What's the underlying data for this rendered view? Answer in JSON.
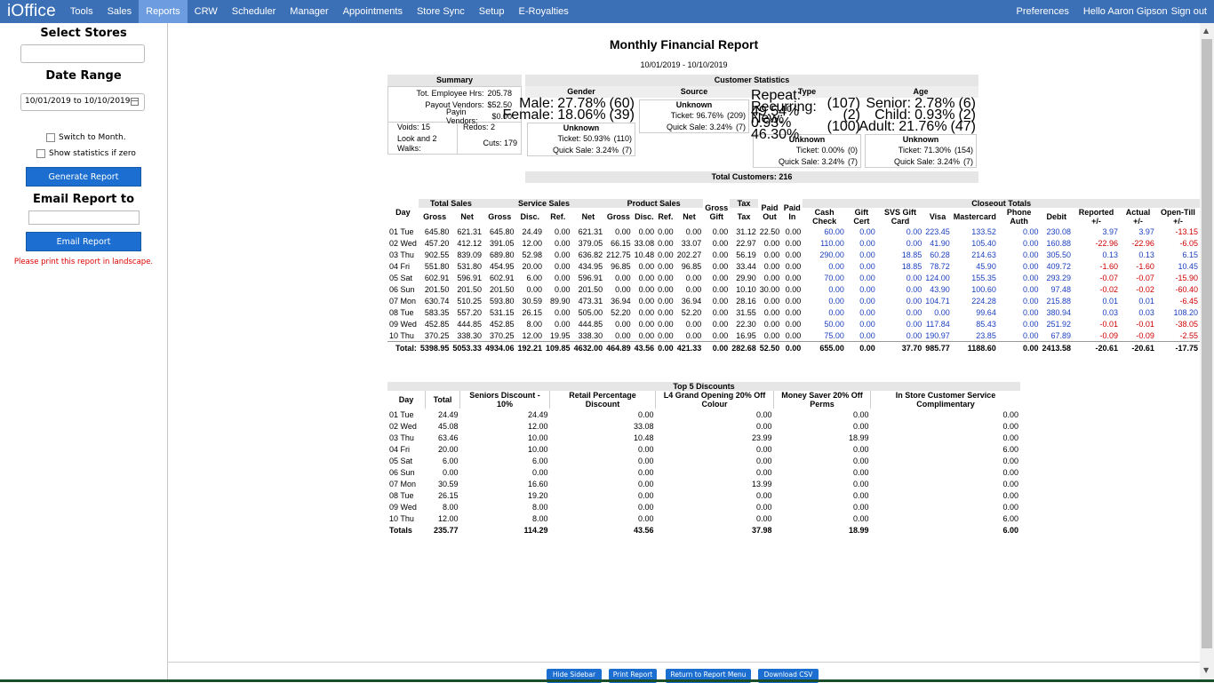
{
  "nav": {
    "logo": "iOffice",
    "items": [
      "Tools",
      "Sales",
      "Reports",
      "CRW",
      "Scheduler",
      "Manager",
      "Appointments",
      "Store Sync",
      "Setup",
      "E-Royalties"
    ],
    "active": "Reports",
    "preferences": "Preferences",
    "greeting": "Hello Aaron Gipson",
    "signout": "Sign out"
  },
  "sidebar": {
    "select_stores": "Select Stores",
    "date_range_title": "Date Range",
    "date_range_value": "10/01/2019 to 10/10/2019",
    "switch_month": "Switch to Month.",
    "show_stats": "Show statistics if zero",
    "generate": "Generate Report",
    "email_title": "Email Report to",
    "email_button": "Email Report",
    "print_note": "Please print this report in landscape."
  },
  "report": {
    "title": "Monthly Financial Report",
    "range": "10/01/2019 - 10/10/2019"
  },
  "summary": {
    "title": "Summary",
    "emp_hrs_label": "Tot. Employee Hrs:",
    "emp_hrs": "205.78",
    "payout_label": "Payout Vendors:",
    "payout": "$52.50",
    "payin_label": "Payin Vendors:",
    "payin": "$0.00",
    "voids": "Voids: 15",
    "redos": "Redos: 2",
    "look_walks": "Look and 2 Walks:",
    "cuts": "Cuts: 179"
  },
  "customer_stats": {
    "title": "Customer Statistics",
    "gender": {
      "title": "Gender",
      "male": "Male:",
      "male_pct": "27.78%",
      "male_n": "(60)",
      "female": "Female:",
      "female_pct": "18.06%",
      "female_n": "(39)",
      "unknown": "Unknown",
      "ticket": "Ticket: 50.93%",
      "ticket_n": "(110)",
      "quick": "Quick Sale: 3.24%",
      "quick_n": "(7)"
    },
    "source": {
      "title": "Source",
      "unknown": "Unknown",
      "ticket": "Ticket: 96.76%",
      "ticket_n": "(209)",
      "quick": "Quick Sale: 3.24%",
      "quick_n": "(7)"
    },
    "type": {
      "title": "Type",
      "repeat": "Repeat: 49.54%",
      "repeat_n": "(107)",
      "recurring": "Recurring: 0.93%",
      "recurring_n": "(2)",
      "new": "New: 46.30%",
      "new_n": "(100)",
      "unknown": "Unknown",
      "ticket": "Ticket: 0.00%",
      "ticket_n": "(0)",
      "quick": "Quick Sale: 3.24%",
      "quick_n": "(7)"
    },
    "age": {
      "title": "Age",
      "senior": "Senior:",
      "senior_pct": "2.78%",
      "senior_n": "(6)",
      "child": "Child:",
      "child_pct": "0.93%",
      "child_n": "(2)",
      "adult": "Adult:",
      "adult_pct": "21.76%",
      "adult_n": "(47)",
      "unknown": "Unknown",
      "ticket": "Ticket: 71.30%",
      "ticket_n": "(154)",
      "quick": "Quick Sale: 3.24%",
      "quick_n": "(7)"
    },
    "total": "Total Customers: 216"
  },
  "sales": {
    "groups": [
      "Total Sales",
      "Service Sales",
      "Product Sales",
      "Tax",
      "Closeout Totals"
    ],
    "headers": [
      "Day",
      "Gross",
      "Net",
      "Gross",
      "Disc.",
      "Ref.",
      "Net",
      "Gross",
      "Disc.",
      "Ref.",
      "Net",
      "Gross Gift",
      "Tax",
      "Paid Out",
      "Paid In",
      "Cash Check",
      "Gift Cert",
      "SVS Gift Card",
      "Visa",
      "Mastercard",
      "Phone Auth",
      "Debit",
      "Reported +/-",
      "Actual +/-",
      "Open-Till +/-"
    ],
    "rows": [
      [
        "01 Tue",
        "645.80",
        "621.31",
        "645.80",
        "24.49",
        "0.00",
        "621.31",
        "0.00",
        "0.00",
        "0.00",
        "0.00",
        "0.00",
        "31.12",
        "22.50",
        "0.00",
        "60.00",
        "0.00",
        "0.00",
        "223.45",
        "133.52",
        "0.00",
        "230.08",
        "3.97",
        "3.97",
        "-13.15"
      ],
      [
        "02 Wed",
        "457.20",
        "412.12",
        "391.05",
        "12.00",
        "0.00",
        "379.05",
        "66.15",
        "33.08",
        "0.00",
        "33.07",
        "0.00",
        "22.97",
        "0.00",
        "0.00",
        "110.00",
        "0.00",
        "0.00",
        "41.90",
        "105.40",
        "0.00",
        "160.88",
        "-22.96",
        "-22.96",
        "-6.05"
      ],
      [
        "03 Thu",
        "902.55",
        "839.09",
        "689.80",
        "52.98",
        "0.00",
        "636.82",
        "212.75",
        "10.48",
        "0.00",
        "202.27",
        "0.00",
        "56.19",
        "0.00",
        "0.00",
        "290.00",
        "0.00",
        "18.85",
        "60.28",
        "214.63",
        "0.00",
        "305.50",
        "0.13",
        "0.13",
        "6.15"
      ],
      [
        "04 Fri",
        "551.80",
        "531.80",
        "454.95",
        "20.00",
        "0.00",
        "434.95",
        "96.85",
        "0.00",
        "0.00",
        "96.85",
        "0.00",
        "33.44",
        "0.00",
        "0.00",
        "0.00",
        "0.00",
        "18.85",
        "78.72",
        "45.90",
        "0.00",
        "409.72",
        "-1.60",
        "-1.60",
        "10.45"
      ],
      [
        "05 Sat",
        "602.91",
        "596.91",
        "602.91",
        "6.00",
        "0.00",
        "596.91",
        "0.00",
        "0.00",
        "0.00",
        "0.00",
        "0.00",
        "29.90",
        "0.00",
        "0.00",
        "70.00",
        "0.00",
        "0.00",
        "124.00",
        "155.35",
        "0.00",
        "293.29",
        "-0.07",
        "-0.07",
        "-15.90"
      ],
      [
        "06 Sun",
        "201.50",
        "201.50",
        "201.50",
        "0.00",
        "0.00",
        "201.50",
        "0.00",
        "0.00",
        "0.00",
        "0.00",
        "0.00",
        "10.10",
        "30.00",
        "0.00",
        "0.00",
        "0.00",
        "0.00",
        "43.90",
        "100.60",
        "0.00",
        "97.48",
        "-0.02",
        "-0.02",
        "-60.40"
      ],
      [
        "07 Mon",
        "630.74",
        "510.25",
        "593.80",
        "30.59",
        "89.90",
        "473.31",
        "36.94",
        "0.00",
        "0.00",
        "36.94",
        "0.00",
        "28.16",
        "0.00",
        "0.00",
        "0.00",
        "0.00",
        "0.00",
        "104.71",
        "224.28",
        "0.00",
        "215.88",
        "0.01",
        "0.01",
        "-6.45"
      ],
      [
        "08 Tue",
        "583.35",
        "557.20",
        "531.15",
        "26.15",
        "0.00",
        "505.00",
        "52.20",
        "0.00",
        "0.00",
        "52.20",
        "0.00",
        "31.55",
        "0.00",
        "0.00",
        "0.00",
        "0.00",
        "0.00",
        "0.00",
        "99.64",
        "0.00",
        "380.94",
        "0.03",
        "0.03",
        "108.20"
      ],
      [
        "09 Wed",
        "452.85",
        "444.85",
        "452.85",
        "8.00",
        "0.00",
        "444.85",
        "0.00",
        "0.00",
        "0.00",
        "0.00",
        "0.00",
        "22.30",
        "0.00",
        "0.00",
        "50.00",
        "0.00",
        "0.00",
        "117.84",
        "85.43",
        "0.00",
        "251.92",
        "-0.01",
        "-0.01",
        "-38.05"
      ],
      [
        "10 Thu",
        "370.25",
        "338.30",
        "370.25",
        "12.00",
        "19.95",
        "338.30",
        "0.00",
        "0.00",
        "0.00",
        "0.00",
        "0.00",
        "16.95",
        "0.00",
        "0.00",
        "75.00",
        "0.00",
        "0.00",
        "190.97",
        "23.85",
        "0.00",
        "67.89",
        "-0.09",
        "-0.09",
        "-2.55"
      ]
    ],
    "totals": [
      "Total:",
      "5398.95",
      "5053.33",
      "4934.06",
      "192.21",
      "109.85",
      "4632.00",
      "464.89",
      "43.56",
      "0.00",
      "421.33",
      "0.00",
      "282.68",
      "52.50",
      "0.00",
      "655.00",
      "0.00",
      "37.70",
      "985.77",
      "1188.60",
      "0.00",
      "2413.58",
      "-20.61",
      "-20.61",
      "-17.75"
    ]
  },
  "discounts": {
    "title": "Top 5 Discounts",
    "headers": [
      "Day",
      "Total",
      "Seniors Discount - 10%",
      "Retail Percentage Discount",
      "L4 Grand Opening 20% Off Colour",
      "Money Saver 20% Off Perms",
      "In Store Customer Service Complimentary"
    ],
    "rows": [
      [
        "01 Tue",
        "24.49",
        "24.49",
        "0.00",
        "0.00",
        "0.00",
        "0.00"
      ],
      [
        "02 Wed",
        "45.08",
        "12.00",
        "33.08",
        "0.00",
        "0.00",
        "0.00"
      ],
      [
        "03 Thu",
        "63.46",
        "10.00",
        "10.48",
        "23.99",
        "18.99",
        "0.00"
      ],
      [
        "04 Fri",
        "20.00",
        "10.00",
        "0.00",
        "0.00",
        "0.00",
        "6.00"
      ],
      [
        "05 Sat",
        "6.00",
        "6.00",
        "0.00",
        "0.00",
        "0.00",
        "0.00"
      ],
      [
        "06 Sun",
        "0.00",
        "0.00",
        "0.00",
        "0.00",
        "0.00",
        "0.00"
      ],
      [
        "07 Mon",
        "30.59",
        "16.60",
        "0.00",
        "13.99",
        "0.00",
        "0.00"
      ],
      [
        "08 Tue",
        "26.15",
        "19.20",
        "0.00",
        "0.00",
        "0.00",
        "0.00"
      ],
      [
        "09 Wed",
        "8.00",
        "8.00",
        "0.00",
        "0.00",
        "0.00",
        "0.00"
      ],
      [
        "10 Thu",
        "12.00",
        "8.00",
        "0.00",
        "0.00",
        "0.00",
        "6.00"
      ]
    ],
    "totals": [
      "Totals",
      "235.77",
      "114.29",
      "43.56",
      "37.98",
      "18.99",
      "6.00"
    ]
  },
  "bottom": {
    "hide": "Hide Sidebar",
    "print": "Print Report",
    "return": "Return to Report Menu",
    "csv": "Download CSV"
  }
}
